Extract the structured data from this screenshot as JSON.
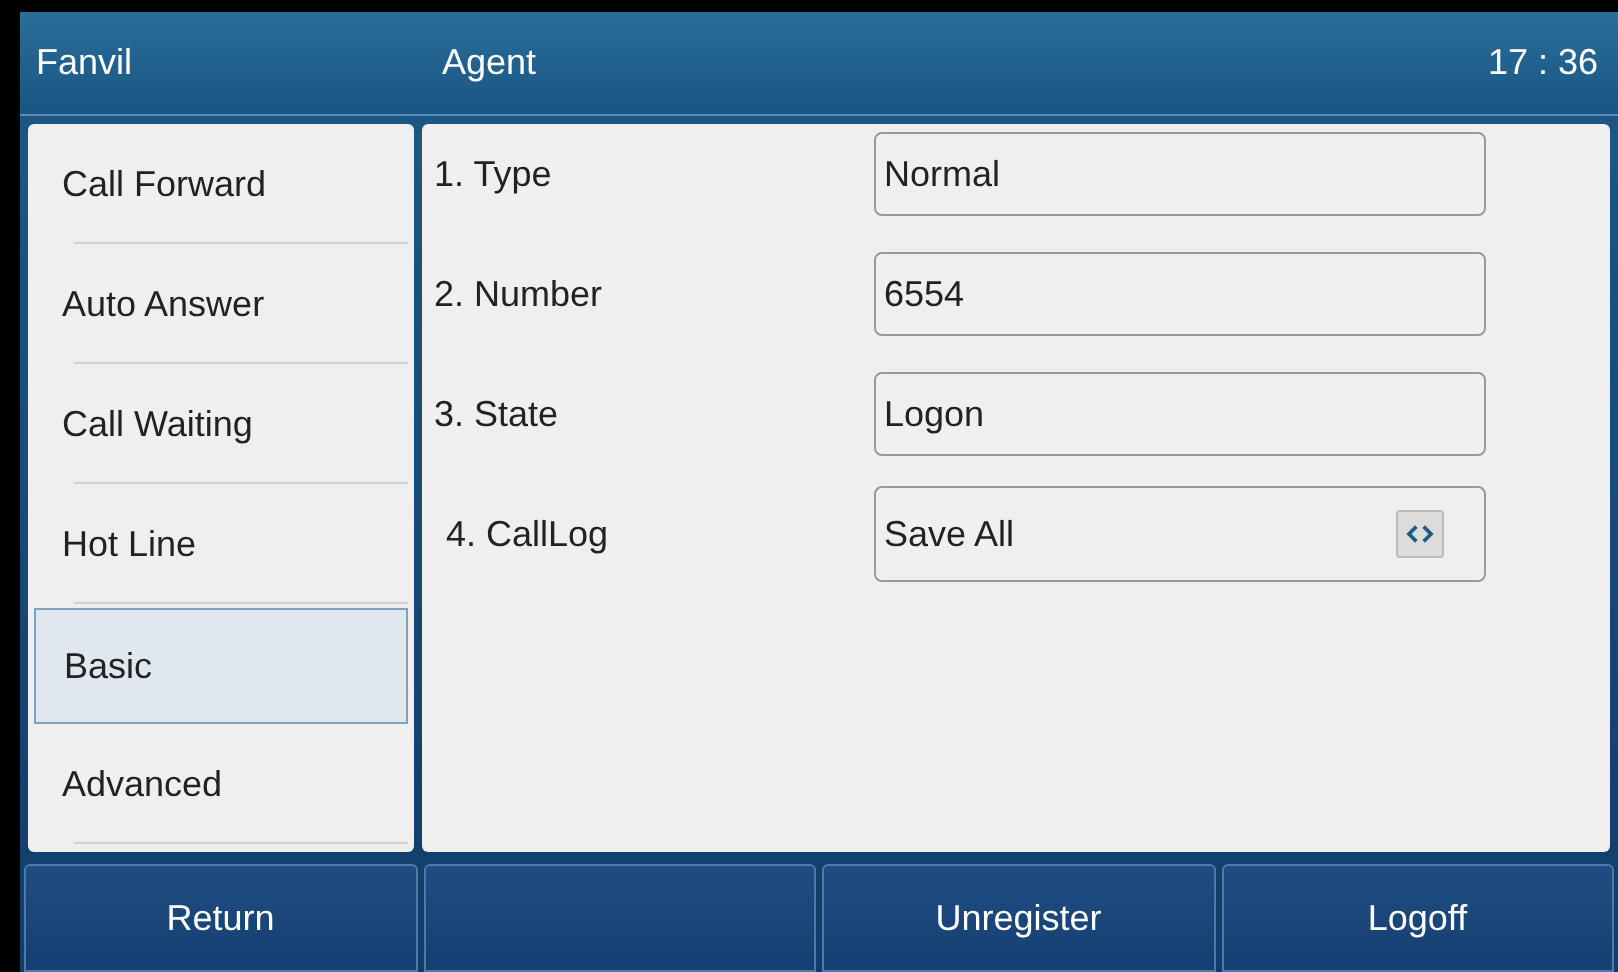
{
  "header": {
    "brand": "Fanvil",
    "title": "Agent",
    "time": "17 : 36"
  },
  "sidebar": {
    "items": [
      {
        "label": "Call Forward",
        "selected": false
      },
      {
        "label": "Auto Answer",
        "selected": false
      },
      {
        "label": "Call Waiting",
        "selected": false
      },
      {
        "label": "Hot Line",
        "selected": false
      },
      {
        "label": "Basic",
        "selected": true
      },
      {
        "label": "Advanced",
        "selected": false
      }
    ]
  },
  "fields": [
    {
      "label": "1. Type",
      "kind": "text",
      "value": "Normal"
    },
    {
      "label": "2. Number",
      "kind": "text",
      "value": "6554"
    },
    {
      "label": "3. State",
      "kind": "text",
      "value": "Logon"
    },
    {
      "label": "4. CallLog",
      "kind": "select",
      "value": "Save All"
    }
  ],
  "softkeys": {
    "softkey_1": "Return",
    "softkey_3": "Unregister",
    "softkey_4": "Logoff"
  }
}
